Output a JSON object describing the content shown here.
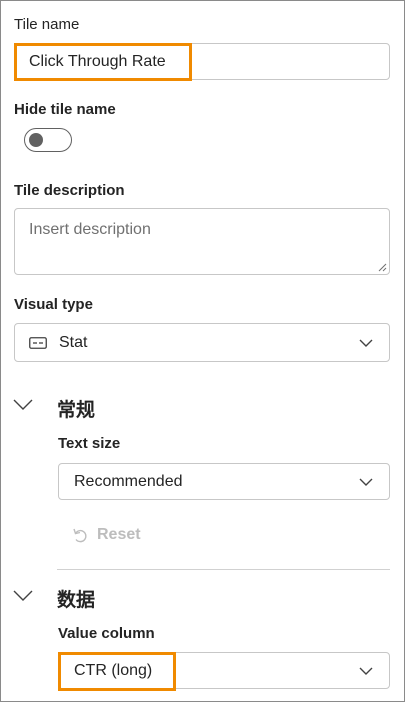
{
  "tile_name": {
    "label": "Tile name",
    "value": "Click Through Rate"
  },
  "hide_tile_name": {
    "label": "Hide tile name",
    "on": false
  },
  "tile_description": {
    "label": "Tile description",
    "placeholder": "Insert description"
  },
  "visual_type": {
    "label": "Visual type",
    "value": "Stat",
    "icon": "stat-icon"
  },
  "general_section": {
    "title": "常规",
    "text_size": {
      "label": "Text size",
      "value": "Recommended"
    },
    "reset_label": "Reset"
  },
  "data_section": {
    "title": "数据",
    "value_column": {
      "label": "Value column",
      "value": "CTR (long)"
    }
  },
  "colors": {
    "highlight": "#f08a00",
    "border": "#c7c7c7",
    "disabled": "#bdbdbd"
  }
}
